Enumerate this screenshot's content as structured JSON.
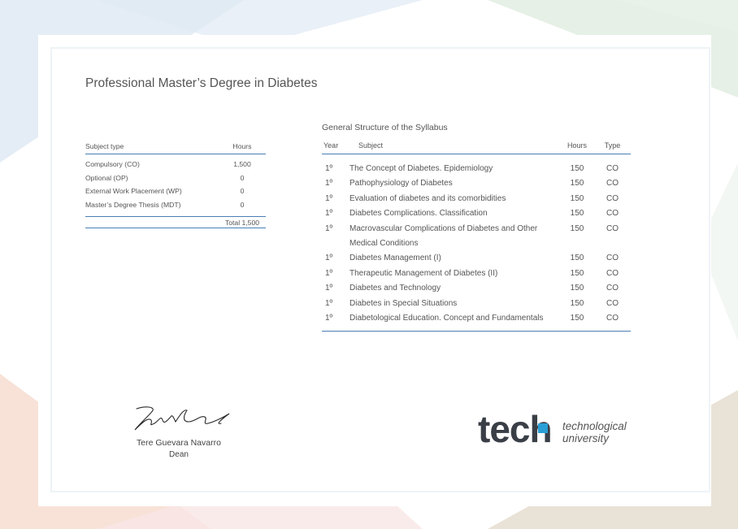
{
  "title": "Professional Master’s Degree in Diabetes",
  "subject_type_table": {
    "headers": {
      "type": "Subject type",
      "hours": "Hours"
    },
    "rows": [
      {
        "type": "Compulsory (CO)",
        "hours": "1,500"
      },
      {
        "type": "Optional (OP)",
        "hours": "0"
      },
      {
        "type": "External Work Placement (WP)",
        "hours": "0"
      },
      {
        "type": "Master’s Degree Thesis (MDT)",
        "hours": "0"
      }
    ],
    "total": "Total 1,500"
  },
  "syllabus": {
    "title": "General Structure of the Syllabus",
    "headers": {
      "year": "Year",
      "subject": "Subject",
      "hours": "Hours",
      "type": "Type"
    },
    "rows": [
      {
        "year": "1º",
        "subject": "The Concept of Diabetes. Epidemiology",
        "hours": "150",
        "type": "CO"
      },
      {
        "year": "1º",
        "subject": "Pathophysiology of Diabetes",
        "hours": "150",
        "type": "CO"
      },
      {
        "year": "1º",
        "subject": "Evaluation of diabetes and its comorbidities",
        "hours": "150",
        "type": "CO"
      },
      {
        "year": "1º",
        "subject": "Diabetes Complications. Classification",
        "hours": "150",
        "type": "CO"
      },
      {
        "year": "1º",
        "subject": "Macrovascular Complications of Diabetes and Other Medical Conditions",
        "hours": "150",
        "type": "CO"
      },
      {
        "year": "1º",
        "subject": "Diabetes Management (I)",
        "hours": "150",
        "type": "CO"
      },
      {
        "year": "1º",
        "subject": "Therapeutic Management of Diabetes (II)",
        "hours": "150",
        "type": "CO"
      },
      {
        "year": "1º",
        "subject": "Diabetes and Technology",
        "hours": "150",
        "type": "CO"
      },
      {
        "year": "1º",
        "subject": "Diabetes in Special Situations",
        "hours": "150",
        "type": "CO"
      },
      {
        "year": "1º",
        "subject": "Diabetological Education. Concept and Fundamentals",
        "hours": "150",
        "type": "CO"
      }
    ]
  },
  "signature": {
    "name": "Tere Guevara Navarro",
    "role": "Dean"
  },
  "logo": {
    "word": "tech",
    "line1": "technological",
    "line2": "university"
  },
  "colors": {
    "accent_line": "#4a7fb5",
    "logo_dark": "#3a3f47",
    "logo_blue": "#2a9fd6"
  },
  "icons": [
    "signature-icon",
    "tech-logo-icon"
  ]
}
